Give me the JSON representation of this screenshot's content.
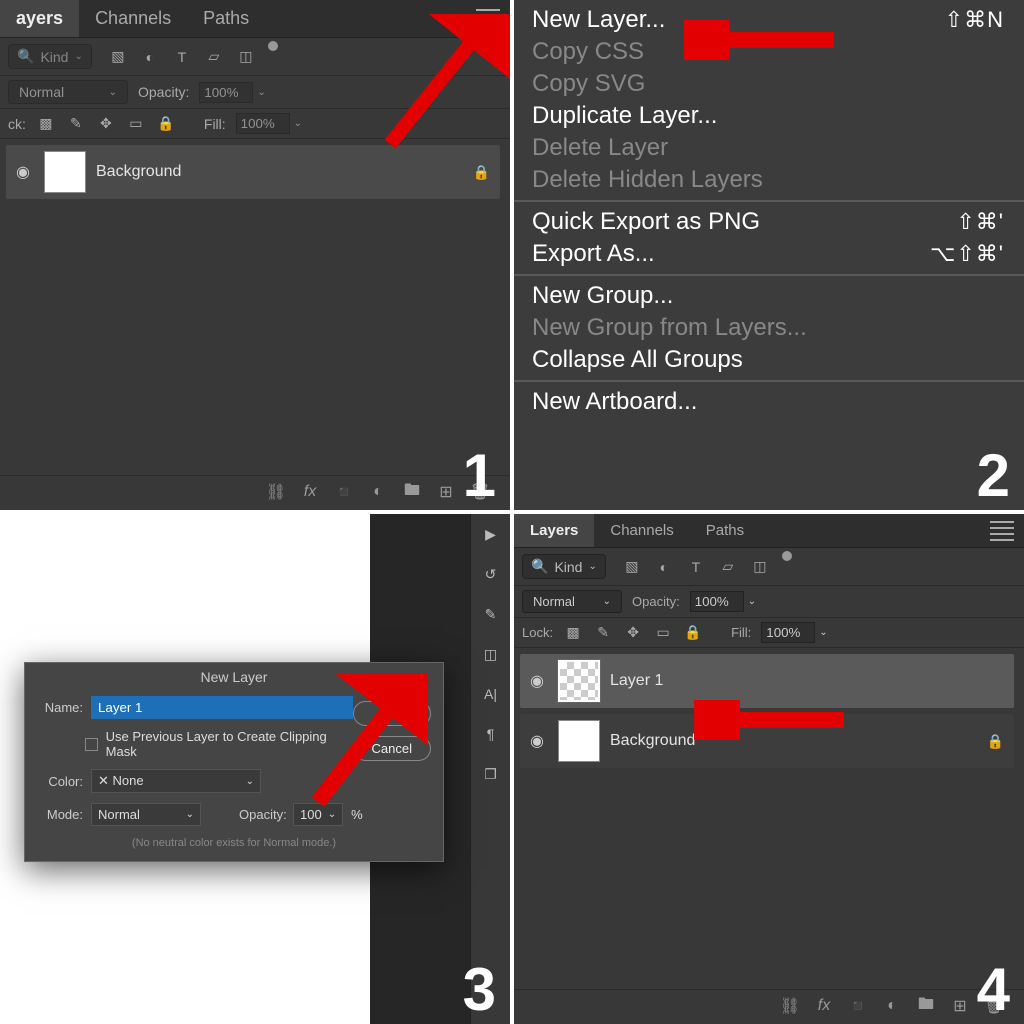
{
  "p1": {
    "tabs": [
      "ayers",
      "Channels",
      "Paths"
    ],
    "kind_label": "Kind",
    "blend_mode": "Normal",
    "opacity_label": "Opacity:",
    "opacity_value": "100%",
    "lock_label": "ck:",
    "fill_label": "Fill:",
    "fill_value": "100%",
    "layer_name": "Background"
  },
  "p2": {
    "sections": [
      {
        "items": [
          {
            "label": "New Layer...",
            "sc": "⇧⌘N",
            "dis": false
          },
          {
            "label": "Copy CSS",
            "sc": "",
            "dis": true
          },
          {
            "label": "Copy SVG",
            "sc": "",
            "dis": true
          },
          {
            "label": "Duplicate Layer...",
            "sc": "",
            "dis": false
          },
          {
            "label": "Delete Layer",
            "sc": "",
            "dis": true
          },
          {
            "label": "Delete Hidden Layers",
            "sc": "",
            "dis": true
          }
        ]
      },
      {
        "items": [
          {
            "label": "Quick Export as PNG",
            "sc": "⇧⌘'",
            "dis": false
          },
          {
            "label": "Export As...",
            "sc": "⌥⇧⌘'",
            "dis": false
          }
        ]
      },
      {
        "items": [
          {
            "label": "New Group...",
            "sc": "",
            "dis": false
          },
          {
            "label": "New Group from Layers...",
            "sc": "",
            "dis": true
          },
          {
            "label": "Collapse All Groups",
            "sc": "",
            "dis": false
          }
        ]
      },
      {
        "items": [
          {
            "label": "New Artboard...",
            "sc": "",
            "dis": false
          }
        ]
      }
    ]
  },
  "p3": {
    "dlg_title": "New Layer",
    "name_label": "Name:",
    "name_value": "Layer 1",
    "clip_label": "Use Previous Layer to Create Clipping Mask",
    "color_label": "Color:",
    "color_value": "None",
    "mode_label": "Mode:",
    "mode_value": "Normal",
    "opacity_label": "Opacity:",
    "opacity_value": "100",
    "opacity_unit": "%",
    "note": "(No neutral color exists for Normal mode.)",
    "ok": "OK",
    "cancel": "Cancel"
  },
  "p4": {
    "tabs": [
      "Layers",
      "Channels",
      "Paths"
    ],
    "kind_label": "Kind",
    "blend_mode": "Normal",
    "opacity_label": "Opacity:",
    "opacity_value": "100%",
    "lock_label": "Lock:",
    "fill_label": "Fill:",
    "fill_value": "100%",
    "layer1": "Layer 1",
    "bg": "Background"
  }
}
